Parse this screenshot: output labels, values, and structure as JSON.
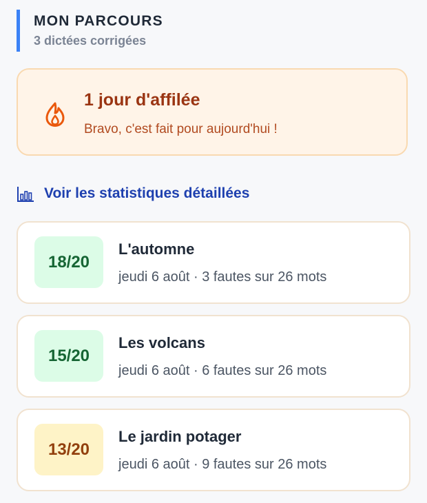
{
  "header": {
    "title": "MON PARCOURS",
    "subtitle": "3 dictées corrigées",
    "accent_color": "#3b82f6"
  },
  "streak": {
    "icon": "flame-icon",
    "title": "1 jour d'affilée",
    "message": "Bravo, c'est fait pour aujourd'hui !"
  },
  "stats_link": {
    "icon": "bar-chart-icon",
    "label": "Voir les statistiques détaillées"
  },
  "dictations": [
    {
      "score": "18/20",
      "score_color": "green",
      "title": "L'automne",
      "meta": "jeudi 6 août · 3 fautes sur 26 mots"
    },
    {
      "score": "15/20",
      "score_color": "green",
      "title": "Les volcans",
      "meta": "jeudi 6 août · 6 fautes sur 26 mots"
    },
    {
      "score": "13/20",
      "score_color": "yellow",
      "title": "Le jardin potager",
      "meta": "jeudi 6 août · 9 fautes sur 26 mots"
    }
  ]
}
